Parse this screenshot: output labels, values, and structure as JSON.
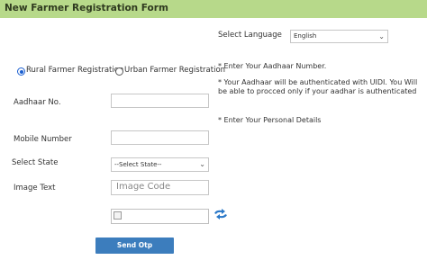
{
  "header": {
    "title": "New Farmer Registration Form"
  },
  "language": {
    "label": "Select Language",
    "selected": "English"
  },
  "farmer_type": {
    "options": [
      {
        "label": "Rural Farmer Registration",
        "checked": true
      },
      {
        "label": "Urban Farmer Registration",
        "checked": false
      }
    ]
  },
  "notes": [
    "*  Enter Your Aadhaar Number.",
    "*  Your Aadhaar will be authenticated with UIDI. You Will be able to procced only if your aadhar is authenticated",
    "*  Enter Your Personal Details"
  ],
  "form": {
    "aadhaar_label": "Aadhaar No.",
    "aadhaar_value": "",
    "mobile_label": "Mobile Number",
    "mobile_value": "",
    "state_label": "Select State",
    "state_selected": "--Select State--",
    "image_text_label": "Image Text",
    "image_code_placeholder": "Image Code"
  },
  "actions": {
    "send_otp": "Send Otp"
  },
  "icons": {
    "refresh": "refresh-captcha-icon",
    "dropdown": "chevron-down-icon",
    "broken_image": "broken-image-icon"
  },
  "colors": {
    "header_bg": "#b7d98a",
    "button_bg": "#3c7dbd",
    "radio_accent": "#1a5fd0",
    "refresh_icon": "#2a78c8"
  }
}
